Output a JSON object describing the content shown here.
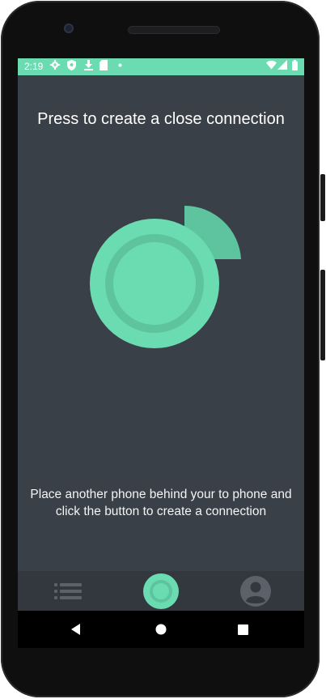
{
  "status_bar": {
    "time": "2:19",
    "left_icons": [
      "gear-icon",
      "shield-icon",
      "download-icon",
      "sd-card-icon",
      "dot-icon"
    ],
    "right_icons": [
      "wifi-icon",
      "signal-icon",
      "battery-icon"
    ]
  },
  "main": {
    "title": "Press to create a close connection",
    "message": "Place another phone behind your to phone and click the button to create a connection"
  },
  "bottom_nav": {
    "items": [
      {
        "icon": "list-icon",
        "active": false
      },
      {
        "icon": "connect-icon",
        "active": true
      },
      {
        "icon": "profile-icon",
        "active": false
      }
    ]
  },
  "system_nav": {
    "buttons": [
      "back-icon",
      "home-icon",
      "recents-icon"
    ]
  },
  "colors": {
    "accent": "#6bdcb2",
    "accent_dark": "#5ec49f",
    "background": "#3a4047",
    "nav_background": "#33383e",
    "inactive_icon": "#5a6168"
  }
}
